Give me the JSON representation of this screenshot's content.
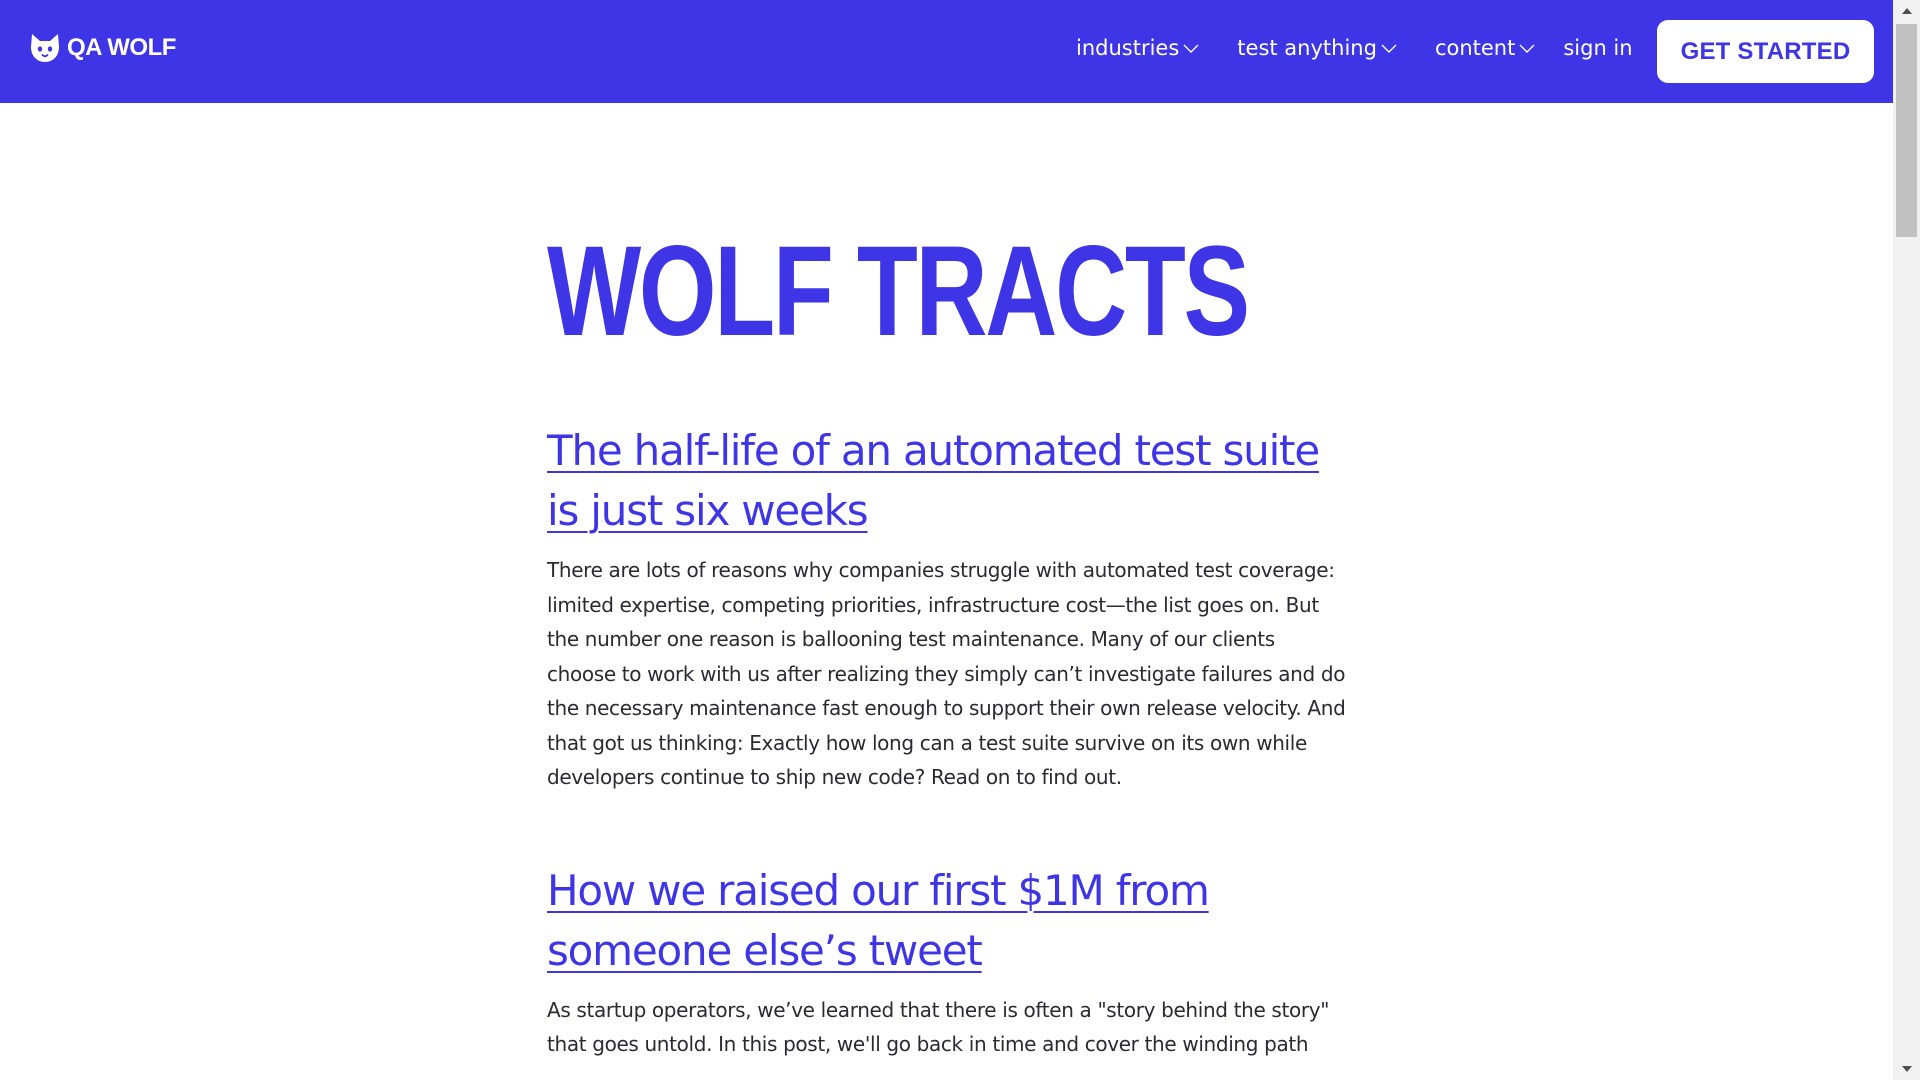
{
  "brand": {
    "name": "QA WOLF",
    "logo_icon": "wolf-head-icon",
    "color": "#3e35e6"
  },
  "nav": {
    "items": [
      {
        "label": "industries",
        "has_dropdown": true
      },
      {
        "label": "test anything",
        "has_dropdown": true
      },
      {
        "label": "content",
        "has_dropdown": true
      },
      {
        "label": "sign in",
        "has_dropdown": false
      }
    ],
    "cta_label": "GET STARTED"
  },
  "page": {
    "title": "WOLF TRACTS"
  },
  "posts": [
    {
      "title": "The half-life of an automated test suite is just six weeks",
      "excerpt": "There are lots of reasons why companies struggle with automated test coverage: limited expertise, competing priorities, infrastructure cost—the list goes on. But the number one reason is ballooning test maintenance. Many of our clients choose to work with us after realizing they simply can’t investigate failures and do the necessary maintenance fast enough to support their own release velocity. And that got us thinking: Exactly how long can a test suite survive on its own while developers continue to ship new code? Read on to find out."
    },
    {
      "title": "How we raised our first $1M from someone else’s tweet",
      "excerpt": "As startup operators, we’ve learned that there is often a \"story behind the story\" that goes untold. In this post, we'll go back in time and cover the winding path"
    }
  ],
  "colors": {
    "header_bg": "#3e35e6",
    "link": "#3e35e6",
    "body_text": "#2a2a33",
    "cta_bg": "#ffffff"
  }
}
